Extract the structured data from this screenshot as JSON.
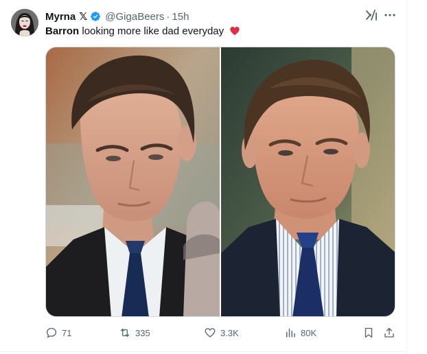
{
  "post": {
    "author": {
      "display_name": "Myrna",
      "badge": "𝕏",
      "handle": "@GigaBeers",
      "separator": "·",
      "time": "15h"
    },
    "text": {
      "bold": "Barron",
      "rest": " looking more like dad everyday"
    },
    "media": {
      "images": [
        "young man in dark suit and navy tie",
        "man in pinstripe shirt and navy tie"
      ]
    },
    "actions": {
      "replies": "71",
      "reposts": "335",
      "likes": "3.3K",
      "views": "80K"
    }
  },
  "colors": {
    "text_primary": "#0f1419",
    "text_secondary": "#536471",
    "verified": "#1d9bf0",
    "heart": "#e0245e"
  }
}
